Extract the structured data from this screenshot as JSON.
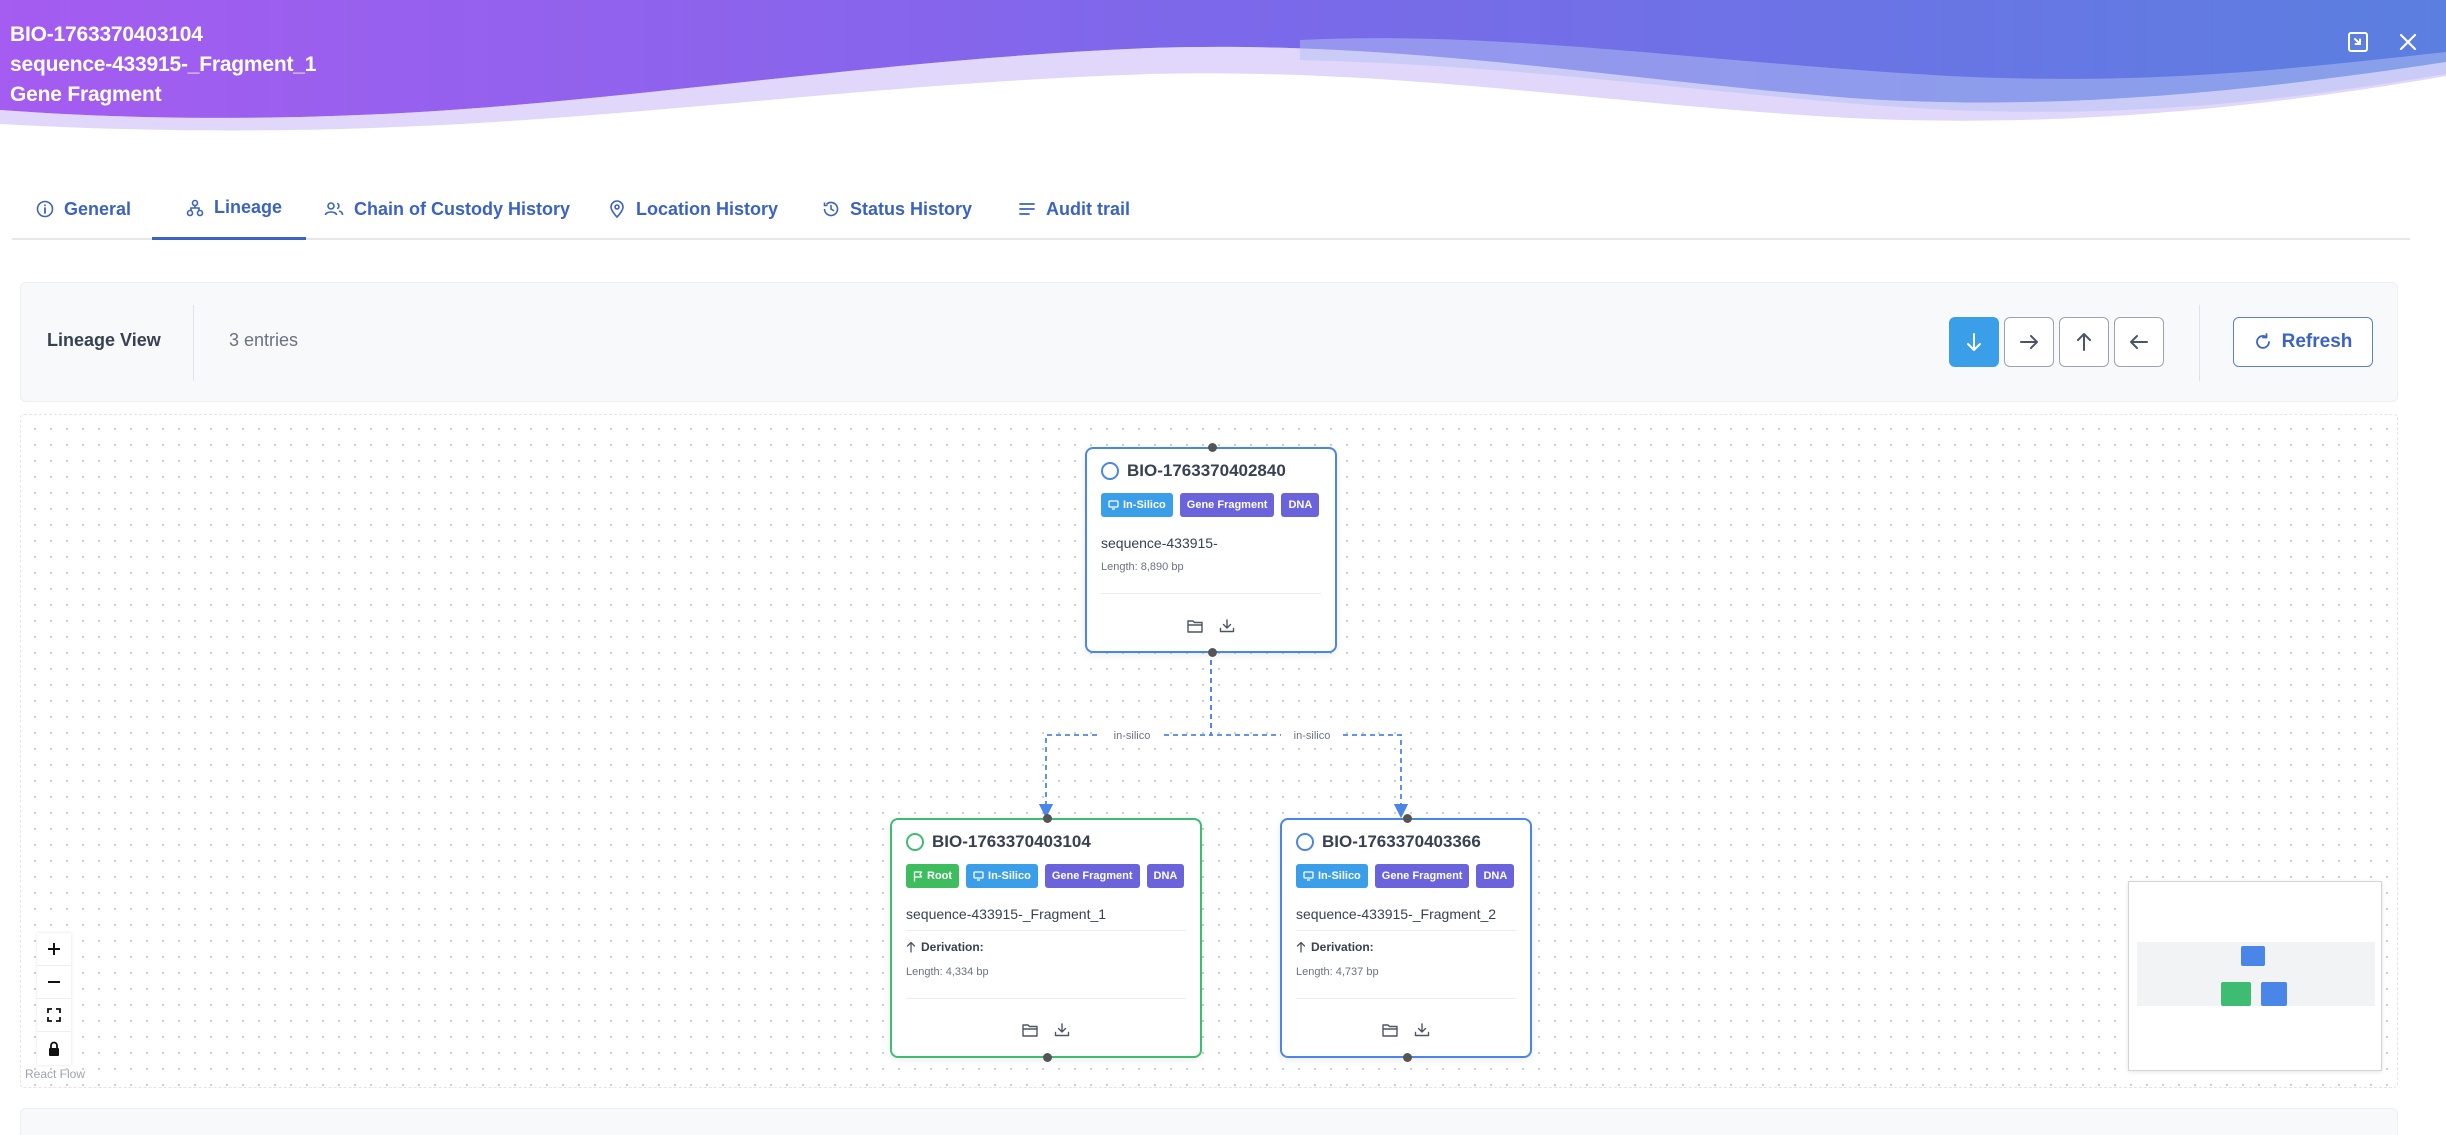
{
  "header": {
    "id": "BIO-1763370403104",
    "name": "sequence-433915-_Fragment_1",
    "type": "Gene Fragment",
    "collapse_icon": "collapse-icon",
    "close_icon": "close-icon",
    "gradient": [
      "#a55cf0",
      "#6d6ee6",
      "#5b7fe0"
    ]
  },
  "tabs": [
    {
      "label": "General",
      "icon": "info-icon"
    },
    {
      "label": "Lineage",
      "icon": "lineage-icon",
      "active": true
    },
    {
      "label": "Chain of Custody History",
      "icon": "users-icon"
    },
    {
      "label": "Location History",
      "icon": "map-pin-icon"
    },
    {
      "label": "Status History",
      "icon": "history-icon"
    },
    {
      "label": "Audit trail",
      "icon": "list-icon"
    }
  ],
  "lineage": {
    "title": "Lineage View",
    "count": "3 entries",
    "directions": [
      "arrow-down-icon",
      "arrow-right-icon",
      "arrow-up-icon",
      "arrow-left-icon"
    ],
    "active_direction": "arrow-down-icon",
    "refresh_label": "Refresh"
  },
  "nodes": [
    {
      "id": "BIO-1763370402840",
      "badges": [
        "In-Silico",
        "Gene Fragment",
        "DNA"
      ],
      "name": "sequence-433915-",
      "length": "Length: 8,890 bp"
    },
    {
      "id": "BIO-1763370403104",
      "badges": [
        "Root",
        "In-Silico",
        "Gene Fragment",
        "DNA"
      ],
      "name": "sequence-433915-_Fragment_1",
      "derivation": "Derivation:",
      "length": "Length: 4,334 bp"
    },
    {
      "id": "BIO-1763370403366",
      "badges": [
        "In-Silico",
        "Gene Fragment",
        "DNA"
      ],
      "name": "sequence-433915-_Fragment_2",
      "derivation": "Derivation:",
      "length": "Length: 4,737 bp"
    }
  ],
  "edges": [
    {
      "label": "in-silico"
    },
    {
      "label": "in-silico"
    }
  ],
  "flow": {
    "controls": [
      "plus-icon",
      "minus-icon",
      "fit-view-icon",
      "lock-icon"
    ],
    "attribution": "React Flow"
  },
  "colors": {
    "accent": "#3b63c4",
    "node_border": "#4a86e8",
    "root_border": "#3ebd72",
    "badge_in_silico": "#3b9ee8",
    "badge_gene_fragment": "#6b63dc",
    "badge_dna": "#6b63dc",
    "badge_root": "#3ebd5e"
  }
}
